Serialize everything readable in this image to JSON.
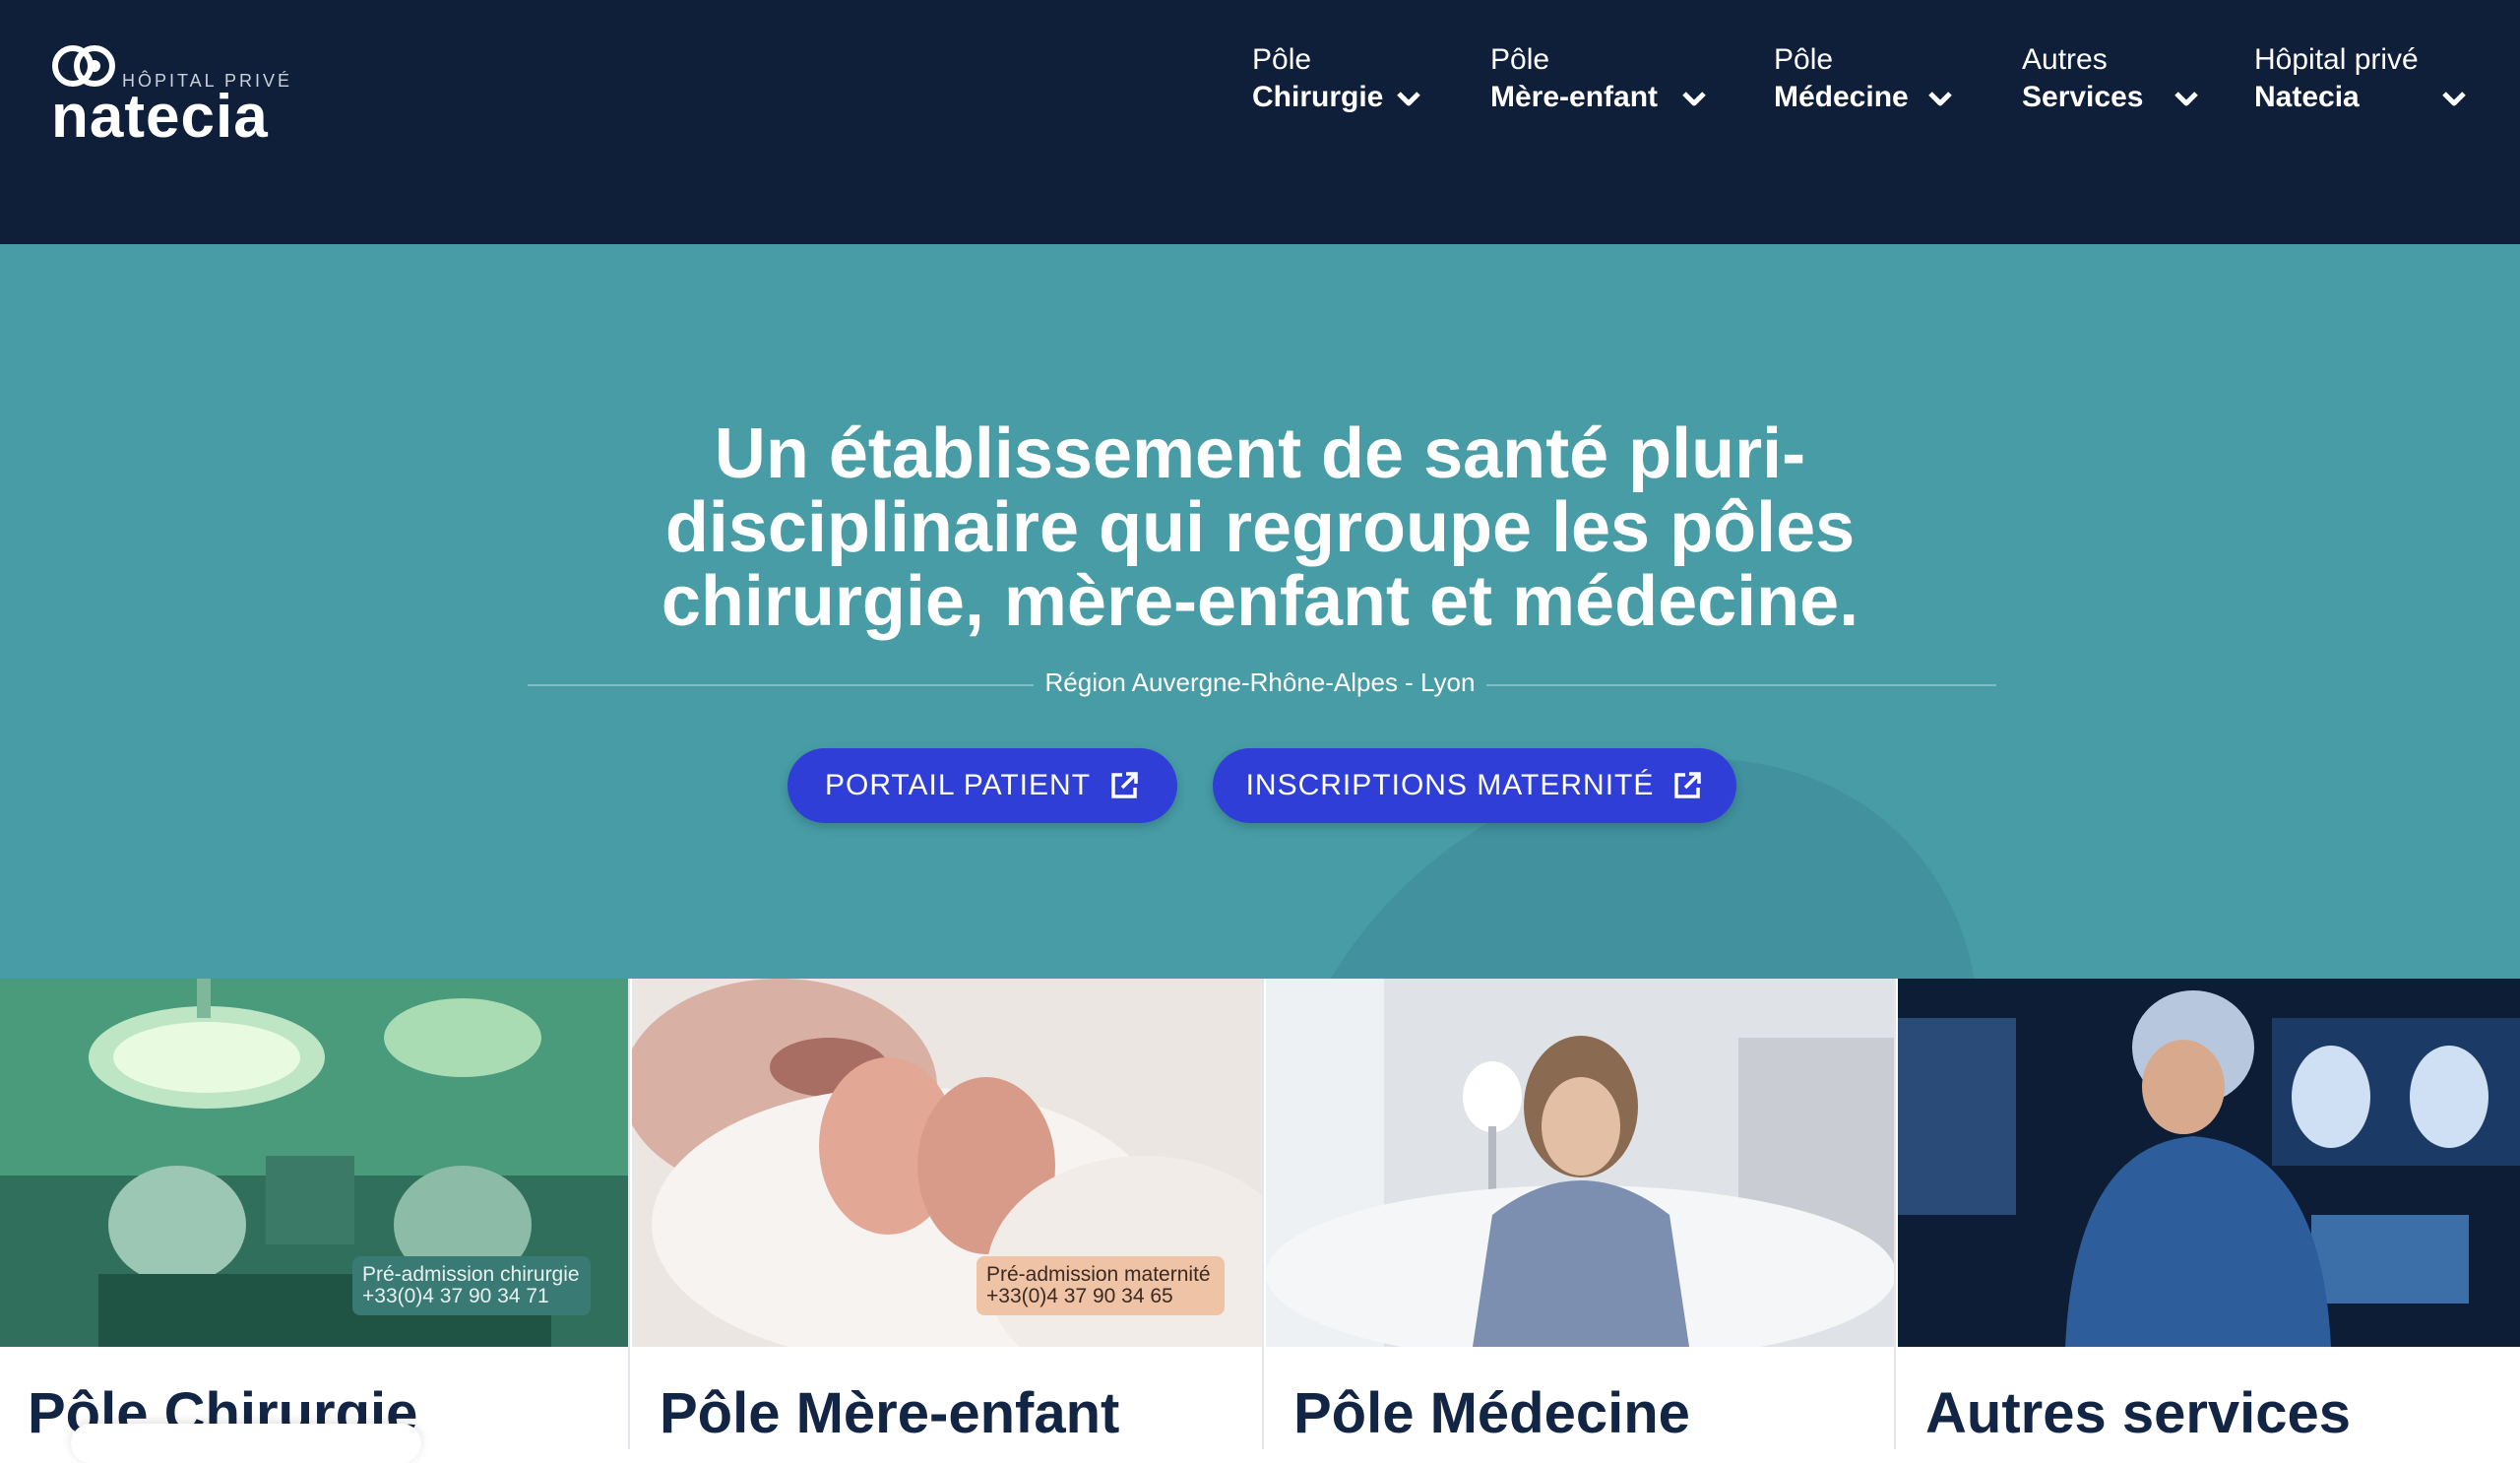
{
  "header": {
    "logo": {
      "tag": "HÔPITAL PRIVÉ",
      "name": "natecia"
    },
    "nav": [
      {
        "line1": "Pôle",
        "line2": "Chirurgie"
      },
      {
        "line1": "Pôle",
        "line2": "Mère-enfant"
      },
      {
        "line1": "Pôle",
        "line2": "Médecine"
      },
      {
        "line1": "Autres",
        "line2": "Services"
      },
      {
        "line1": "Hôpital privé",
        "line2": "Natecia"
      }
    ]
  },
  "hero": {
    "title_lines": [
      "Un établissement de santé pluri-",
      "disciplinaire qui regroupe les pôles",
      "chirurgie, mère-enfant et médecine."
    ],
    "region": "Région Auvergne-Rhône-Alpes - Lyon",
    "buttons": [
      {
        "label": "PORTAIL PATIENT",
        "icon": "external-link-icon"
      },
      {
        "label": "INSCRIPTIONS MATERNITÉ",
        "icon": "external-link-icon"
      }
    ]
  },
  "cards": [
    {
      "title": "Pôle Chirurgie",
      "badge_label": "Pré-admission chirurgie",
      "badge_phone": "+33(0)4 37 90 34 71"
    },
    {
      "title": "Pôle Mère-enfant",
      "badge_label": "Pré-admission maternité",
      "badge_phone": "+33(0)4 37 90 34 65"
    },
    {
      "title": "Pôle Médecine"
    },
    {
      "title": "Autres services"
    }
  ],
  "colors": {
    "header_bg": "#0f1f3a",
    "hero_bg": "#479ca6",
    "button_bg": "#2f3ed6",
    "card_title": "#132544"
  }
}
